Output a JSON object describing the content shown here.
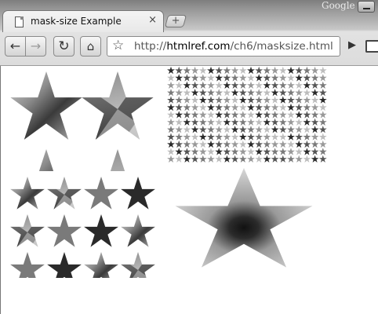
{
  "browser": {
    "tab_title": "mask-size Example",
    "tab_close": "×",
    "new_tab": "+",
    "brand": "Google",
    "url_prefix": "http://",
    "url_host": "htmlref.com",
    "url_path": "/ch6/masksize.html",
    "back_glyph": "←",
    "forward_glyph": "→",
    "reload_glyph": "↻",
    "home_glyph": "⌂",
    "bookmark_glyph": "☆",
    "go_glyph": "▶"
  },
  "content": {
    "demos": [
      {
        "id": "demo-large-stars",
        "description": "mask repeated at 2 large stars per row"
      },
      {
        "id": "demo-tiny-stars",
        "description": "mask at small size tiled"
      },
      {
        "id": "demo-medium-stars",
        "description": "mask at medium size tiled"
      },
      {
        "id": "demo-single-star",
        "description": "single stretched star mask"
      }
    ],
    "colors": {
      "star_dark": "#2a2a2a",
      "star_mid": "#7a7a7a",
      "star_light": "#bdbdbd"
    }
  }
}
